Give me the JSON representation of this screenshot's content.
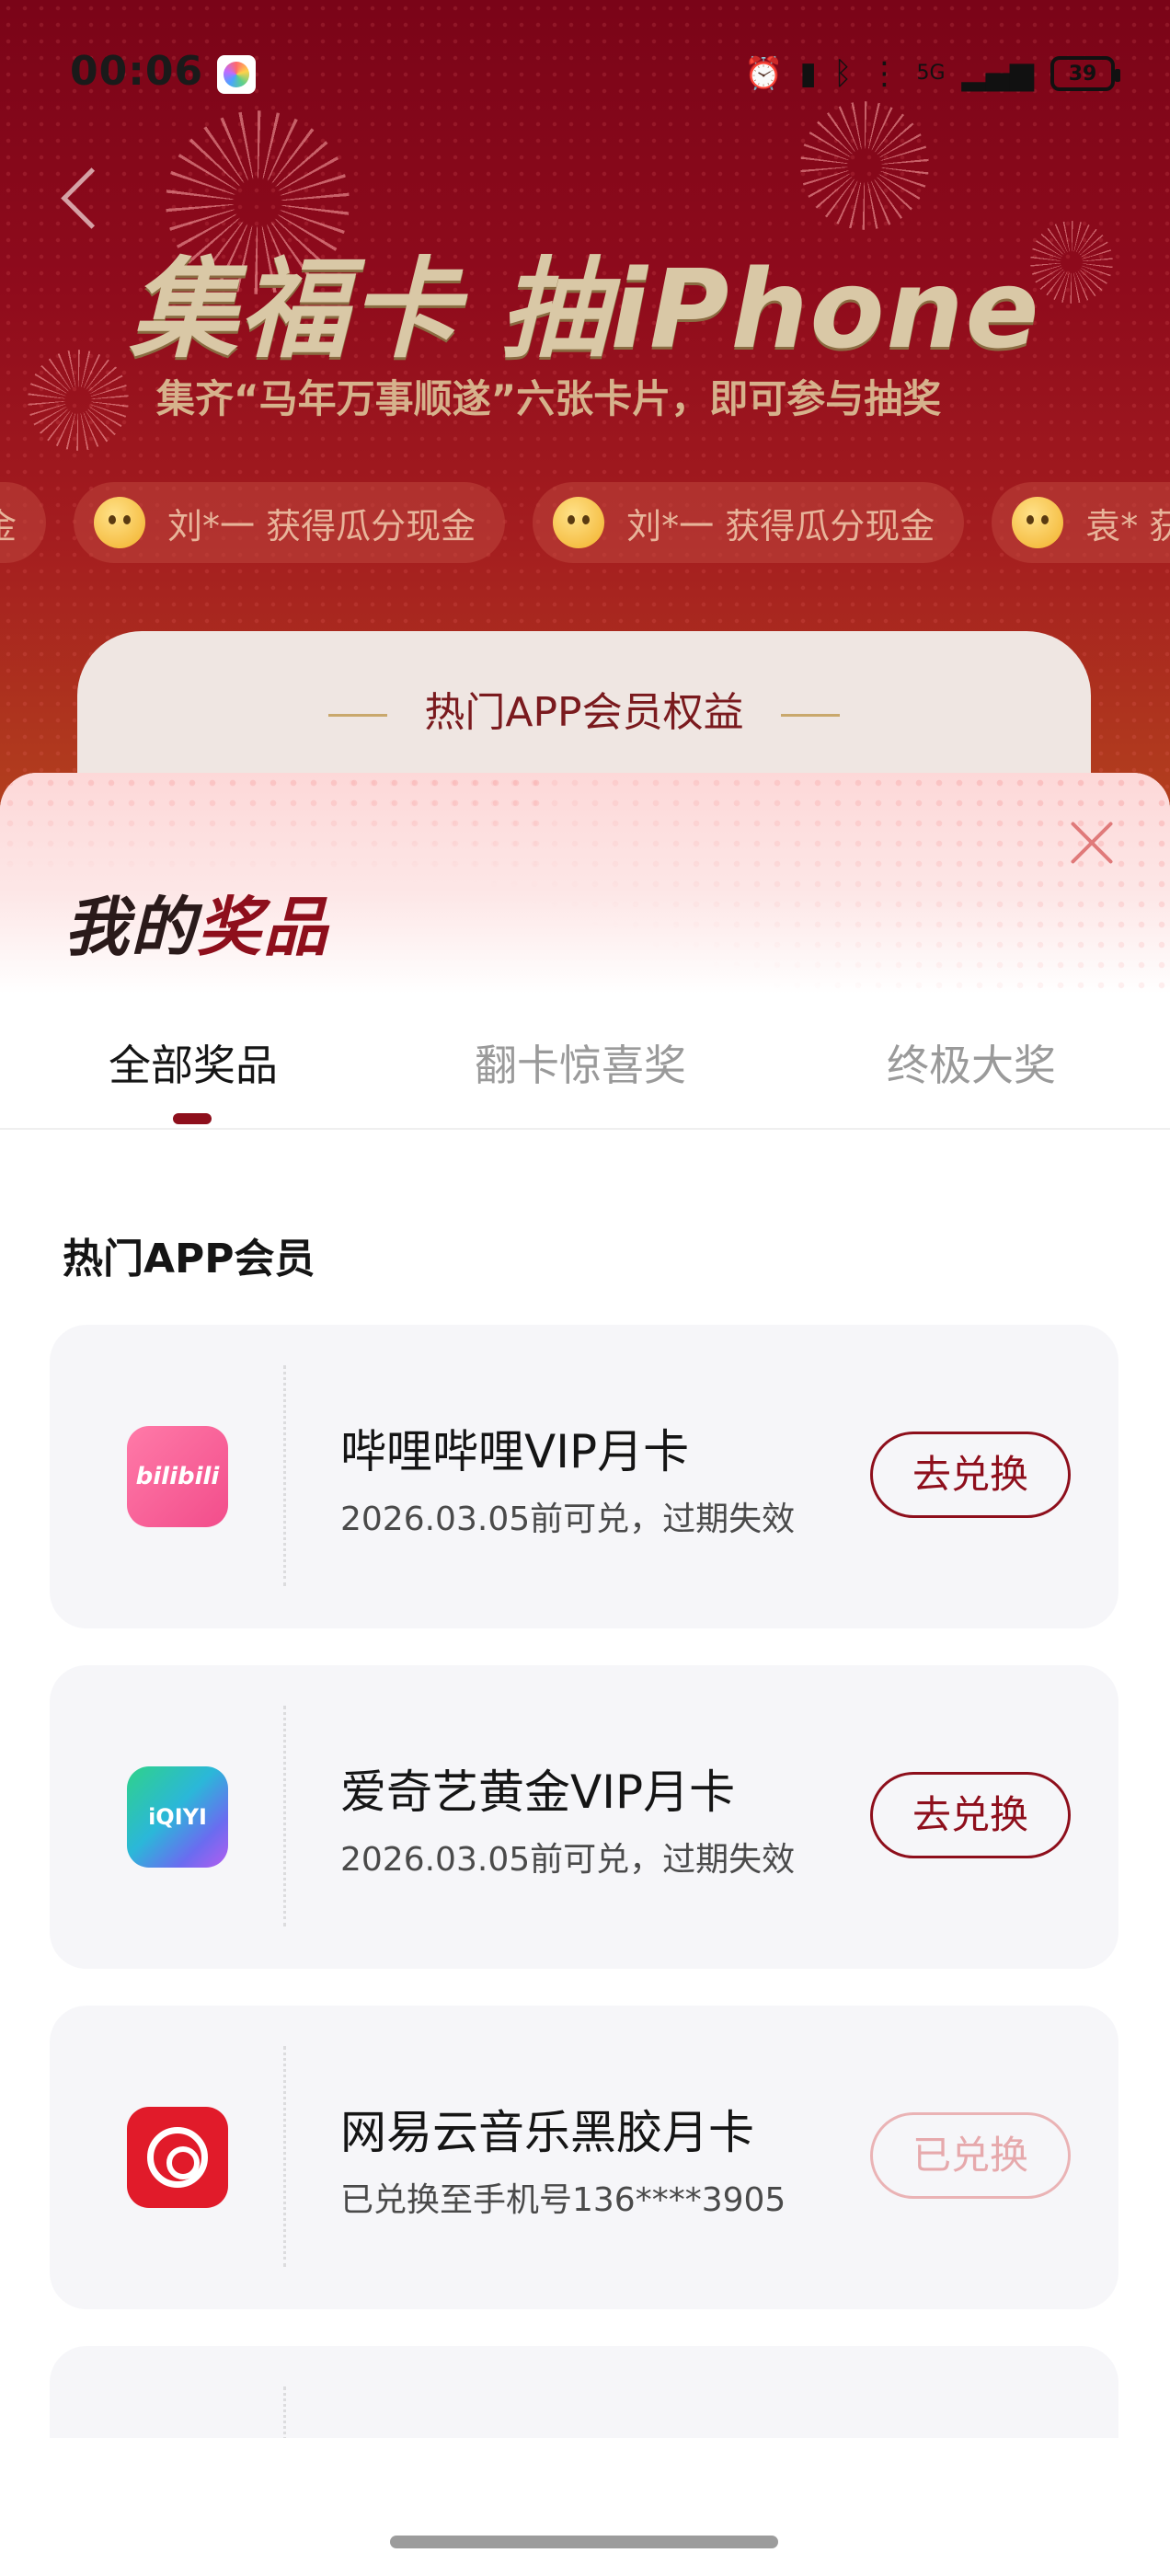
{
  "status_bar": {
    "time": "00:06",
    "icons": [
      "alarm-icon",
      "vibrate-icon",
      "bluetooth-icon",
      "wifi-icon",
      "signal-5g-icon"
    ],
    "network_label": "5G",
    "battery": "39"
  },
  "campaign": {
    "title": "集福卡 抽iPhone",
    "subtitle": "集齐“马年万事顺遂”六张卡片，即可参与抽奖",
    "ticker": [
      "刘*一 获得瓜分现金",
      "刘*一 获得瓜分现金",
      "刘*一 获得瓜分现金",
      "袁* 获"
    ],
    "ticker_partial_left": "金",
    "rights_card_title": "热门APP会员权益"
  },
  "sheet": {
    "title_part1": "我的",
    "title_part2": "奖品",
    "tabs": [
      {
        "label": "全部奖品",
        "active": true
      },
      {
        "label": "翻卡惊喜奖",
        "active": false
      },
      {
        "label": "终极大奖",
        "active": false
      }
    ],
    "section_heading": "热门APP会员",
    "prizes": [
      {
        "name": "哔哩哔哩VIP月卡",
        "note": "2026.03.05前可兑，过期失效",
        "button": "去兑换",
        "redeemed": false,
        "icon": "bilibili-icon",
        "icon_text": "bilibili"
      },
      {
        "name": "爱奇艺黄金VIP月卡",
        "note": "2026.03.05前可兑，过期失效",
        "button": "去兑换",
        "redeemed": false,
        "icon": "iqiyi-icon",
        "icon_text": "iQIYI"
      },
      {
        "name": "网易云音乐黑胶月卡",
        "note": "已兑换至手机号136****3905",
        "button": "已兑换",
        "redeemed": true,
        "icon": "netease-music-icon"
      }
    ]
  },
  "colors": {
    "brand": "#8e0f1c",
    "redeemed_button": "#e6a9ac",
    "card_bg": "#f6f6f9"
  }
}
